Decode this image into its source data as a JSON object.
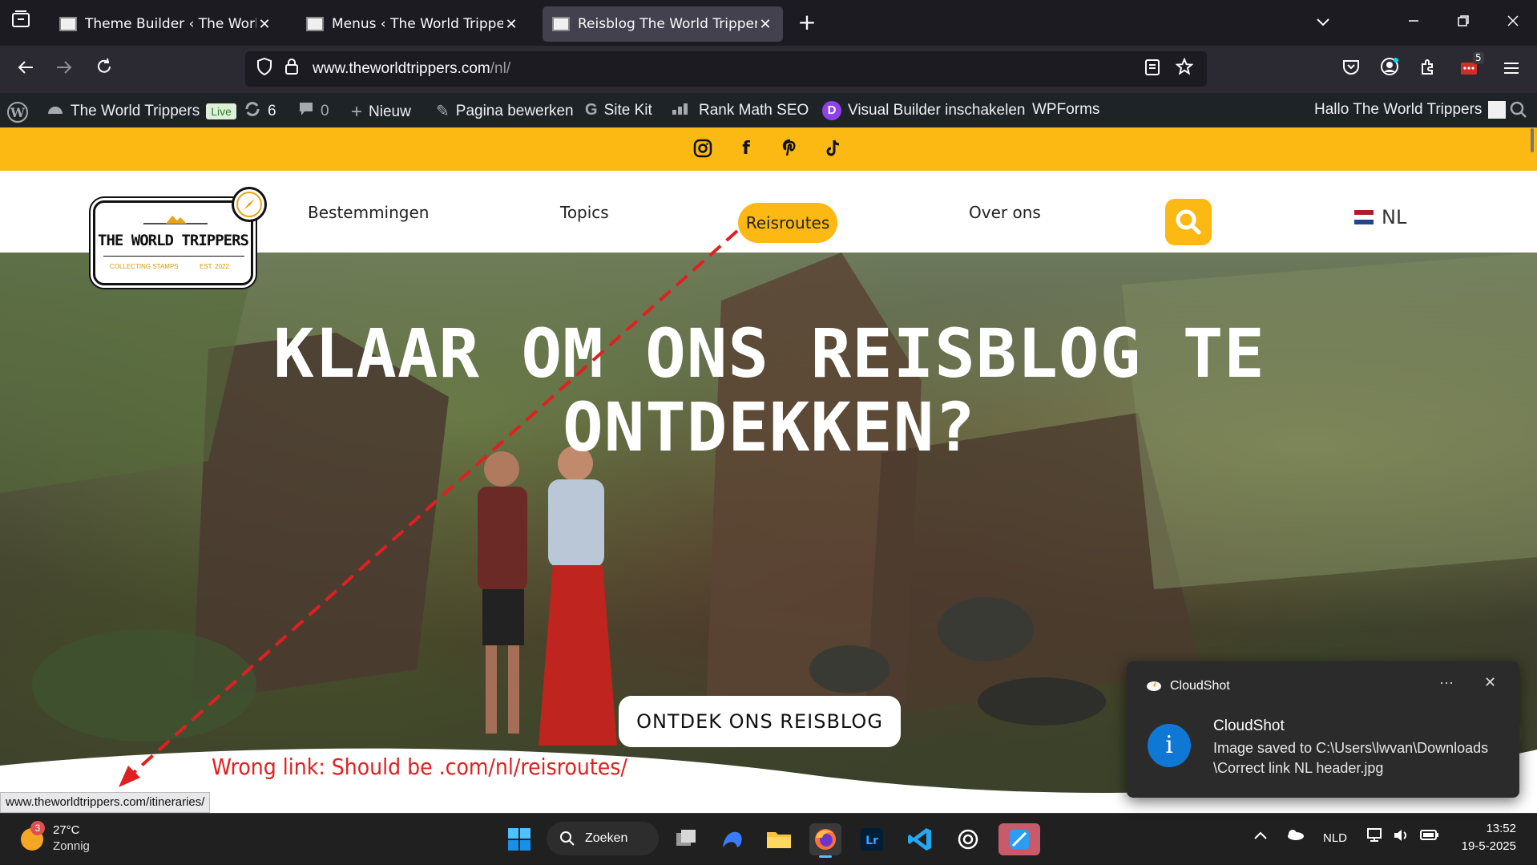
{
  "browser": {
    "tabs": [
      {
        "title": "Theme Builder ‹ The World Tripp",
        "active": false
      },
      {
        "title": "Menus ‹ The World Trippers — V",
        "active": false
      },
      {
        "title": "Reisblog The World Trippers. Vo",
        "active": true
      }
    ],
    "close_glyph": "✕",
    "new_tab_glyph": "+",
    "url_domain": "www.theworldtrippers.com",
    "url_path": "/nl/",
    "extension_badge": "5"
  },
  "adminbar": {
    "site_name": "The World Trippers",
    "live_badge": "Live",
    "updates_count": "6",
    "comments_count": "0",
    "new_label": "Nieuw",
    "edit_page_label": "Pagina bewerken",
    "site_kit_label": "Site Kit",
    "rank_math_label": "Rank Math SEO",
    "visual_builder_label": "Visual Builder inschakelen",
    "wpforms_label": "WPForms",
    "greeting": "Hallo The World Trippers"
  },
  "social": [
    "instagram-icon",
    "facebook-icon",
    "pinterest-icon",
    "tiktok-icon"
  ],
  "site": {
    "logo": {
      "title": "THE WORLD TRIPPERS",
      "sub_left": "COLLECTING STAMPS",
      "sub_right": "EST. 2022"
    },
    "menu": {
      "item1": "Bestemmingen",
      "item2": "Topics",
      "item3": "Reisroutes",
      "item4": "Over ons"
    },
    "language": "NL",
    "accent_color": "#fdb913"
  },
  "hero": {
    "title": "KLAAR OM ONS REISBLOG TE ONTDEKKEN?",
    "button": "ONTDEK ONS REISBLOG"
  },
  "annotation": {
    "text": "Wrong link: Should be .com/nl/reisroutes/",
    "color": "#e02020"
  },
  "status_url": "www.theworldtrippers.com/itineraries/",
  "notification": {
    "app": "CloudShot",
    "title": "CloudShot",
    "body": "Image saved to C:\\Users\\lwvan\\Downloads \\Correct link NL header.jpg",
    "more": "···",
    "close": "✕"
  },
  "taskbar": {
    "weather_temp": "27°C",
    "weather_condition": "Zonnig",
    "weather_badge": "3",
    "search_label": "Zoeken",
    "tray_language": "NLD",
    "time": "13:52",
    "date": "19-5-2025"
  }
}
